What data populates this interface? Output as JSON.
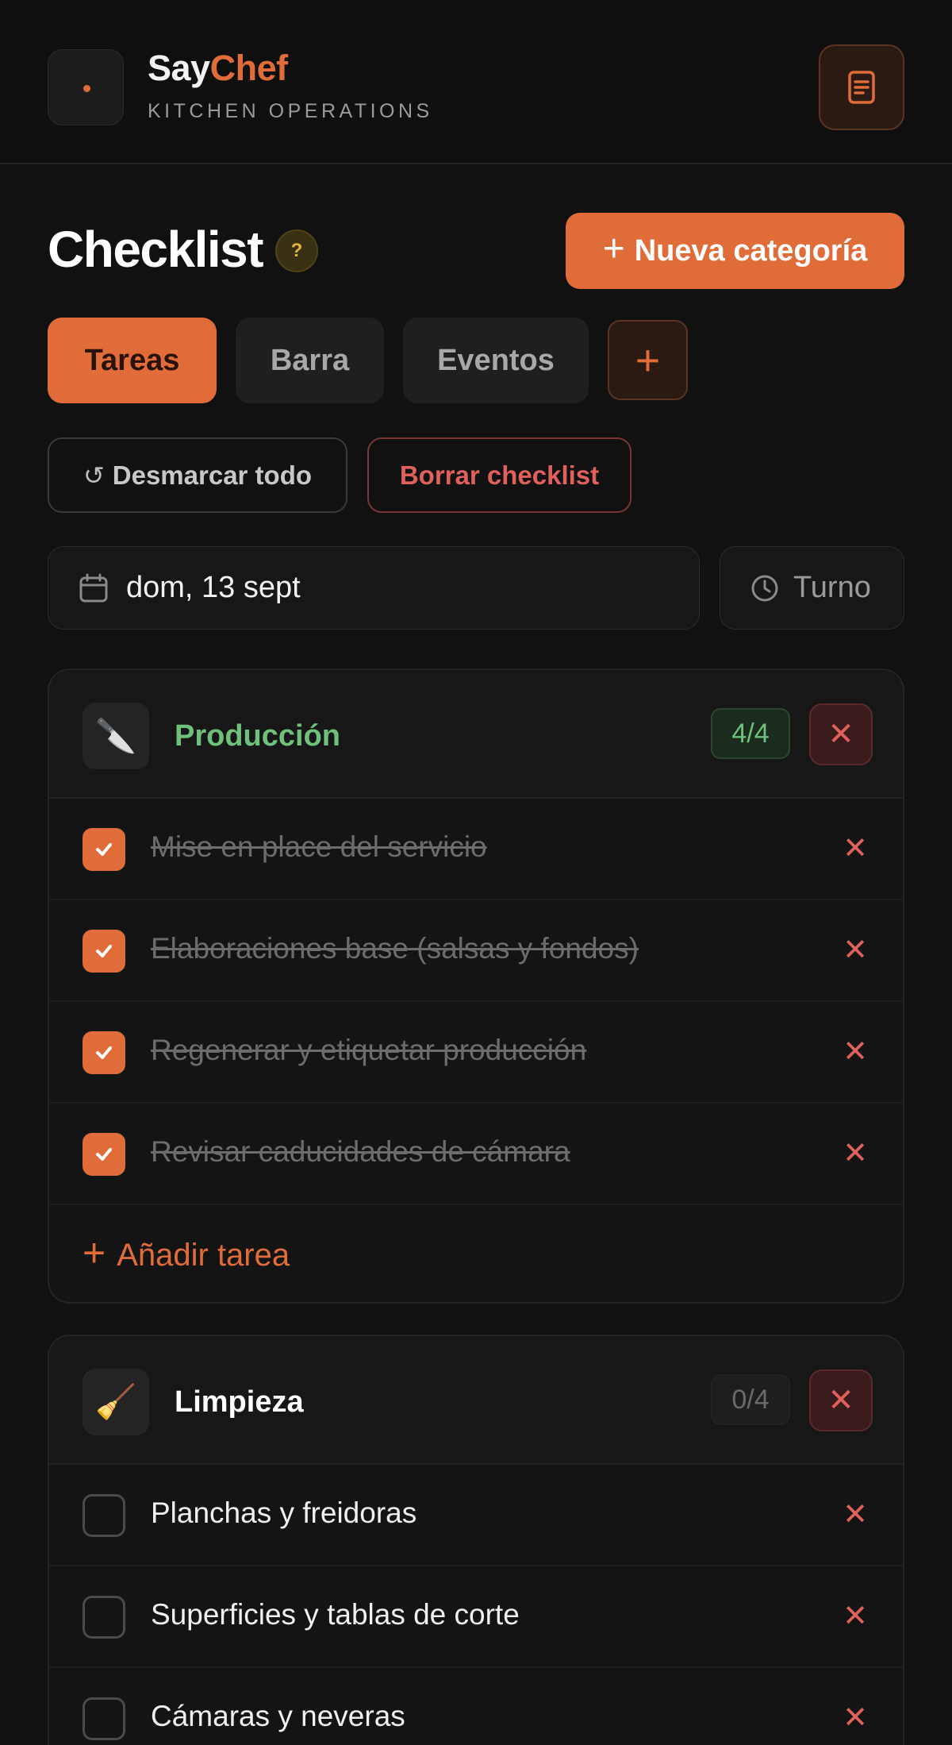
{
  "header": {
    "brand_part1": "Say",
    "brand_part2": "Chef",
    "subtitle": "KITCHEN OPERATIONS",
    "notes_icon": "notes-icon"
  },
  "page": {
    "title": "Checklist",
    "help_label": "?",
    "new_category_label": "Nueva categoría"
  },
  "tabs": [
    {
      "label": "Tareas",
      "active": true
    },
    {
      "label": "Barra",
      "active": false
    },
    {
      "label": "Eventos",
      "active": false
    }
  ],
  "tab_add_label": "+",
  "actions": {
    "uncheck_all_label": "Desmarcar todo",
    "delete_checklist_label": "Borrar checklist"
  },
  "filters": {
    "date_value": "dom, 13 sept",
    "shift_placeholder": "Turno"
  },
  "categories": [
    {
      "name": "Producción",
      "icon": "🔪",
      "count": "4/4",
      "color": "#6ec07a",
      "tasks": [
        {
          "label": "Mise en place del servicio",
          "done": true
        },
        {
          "label": "Elaboraciones base (salsas y fondos)",
          "done": true
        },
        {
          "label": "Regenerar y etiquetar producción",
          "done": true
        },
        {
          "label": "Revisar caducidades de cámara",
          "done": true
        }
      ],
      "add_task_label": "Añadir tarea"
    },
    {
      "name": "Limpieza",
      "icon": "🧹",
      "count": "0/4",
      "color": "#ffffff",
      "tasks": [
        {
          "label": "Planchas y freidoras",
          "done": false
        },
        {
          "label": "Superficies y tablas de corte",
          "done": false
        },
        {
          "label": "Cámaras y neveras",
          "done": false
        }
      ]
    }
  ],
  "colors": {
    "accent": "#e06c3a",
    "background": "#111111",
    "success": "#6ec07a",
    "danger": "#e0605c"
  }
}
